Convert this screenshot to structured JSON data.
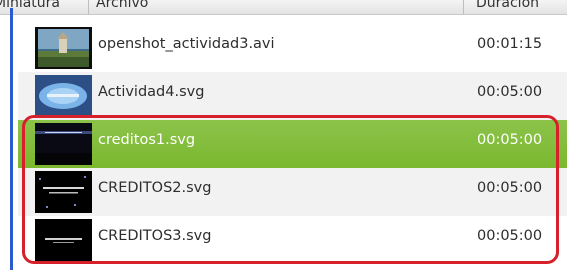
{
  "header": {
    "col_thumbnail": "Miniatura",
    "col_file": "Archivo",
    "col_duration": "Duración"
  },
  "files": [
    {
      "name": "openshot_actividad3.avi",
      "duration": "00:01:15",
      "thumb_icon": "landscape-video-thumbnail",
      "selected": false
    },
    {
      "name": "Actividad4.svg",
      "duration": "00:05:00",
      "thumb_icon": "blue-title-thumbnail",
      "selected": false
    },
    {
      "name": "creditos1.svg",
      "duration": "00:05:00",
      "thumb_icon": "dark-title-thumbnail",
      "selected": true
    },
    {
      "name": "CREDITOS2.svg",
      "duration": "00:05:00",
      "thumb_icon": "credits-text-thumbnail",
      "selected": false
    },
    {
      "name": "CREDITOS3.svg",
      "duration": "00:05:00",
      "thumb_icon": "credits-text-thumbnail",
      "selected": false
    }
  ],
  "colors": {
    "selection": "#7cb82f",
    "annotation": "#d6202a",
    "accent": "#2b5bd0"
  }
}
